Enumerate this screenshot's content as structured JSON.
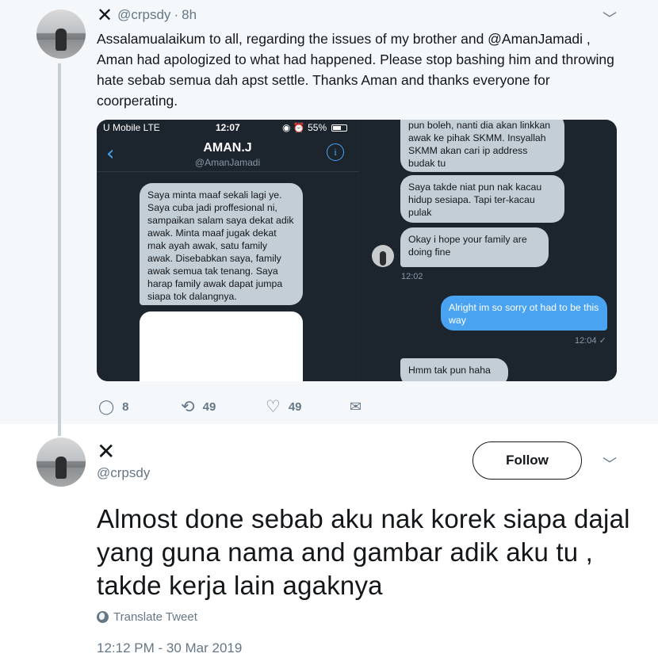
{
  "parent_tweet": {
    "author_handle": "@crpsdy",
    "separator": "·",
    "time_ago": "8h",
    "text": "Assalamualaikum to all, regarding the issues of my brother and @AmanJamadi , Aman had apologized to what had happened. Please stop bashing him and throwing hate sebab semua dah apst settle. Thanks Aman and thanks everyone for coorperating.",
    "media": {
      "left_screenshot": {
        "carrier": "U Mobile  LTE",
        "clock": "12:07",
        "battery": "55%",
        "status_icons": "◉ ⏰",
        "contact_name": "AMAN.J",
        "contact_handle": "@AmanJamadi",
        "message": "Saya minta maaf sekali lagi ye. Saya cuba jadi proffesional ni, sampaikan salam saya dekat adik awak. Minta maaf jugak dekat mak ayah awak, satu family awak. Disebabkan saya, family awak semua tak tenang. Saya harap family awak dapat jumpa siapa tok dalangnya."
      },
      "right_screenshot": {
        "msg1": "pun boleh, nanti dia akan linkkan awak ke pihak SKMM. Insyallah SKMM akan cari ip address budak tu",
        "msg2": "Saya takde niat pun nak kacau hidup sesiapa. Tapi ter-kacau pulak",
        "msg3": "Okay i hope your family are doing fine",
        "time1": "12:02",
        "msg4": "Alright im so sorry ot had to be this way",
        "time2": "12:04 ✓",
        "msg5": "Hmm tak pun haha"
      }
    },
    "actions": {
      "replies": "8",
      "retweets": "49",
      "likes": "49"
    }
  },
  "focused_tweet": {
    "author_handle": "@crpsdy",
    "follow_label": "Follow",
    "text": "Almost done sebab aku nak korek siapa dajal yang guna nama and gambar adik aku tu , takde kerja lain agaknya",
    "translate_label": "Translate Tweet",
    "timestamp": "12:12 PM - 30 Mar 2019"
  },
  "icons": {
    "display_name": "✕",
    "chevron": "﹀",
    "reply": "◯",
    "retweet": "⟲",
    "like": "♡",
    "share": "✉",
    "back": "‹",
    "info": "i"
  },
  "colors": {
    "muted_text": "#657786",
    "chat_bg": "#1c242e",
    "chat_bubble_gray": "#c3ced6",
    "chat_bubble_blue": "#4aa3f0"
  }
}
